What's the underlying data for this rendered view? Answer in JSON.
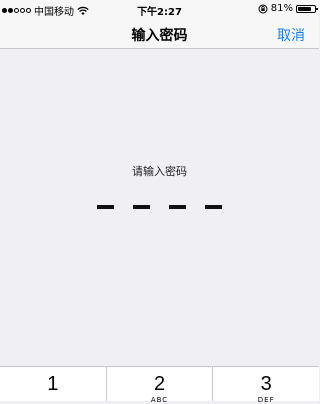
{
  "status_bar": {
    "carrier": "中国移动",
    "time": "下午2:27",
    "battery_percent": "81%",
    "battery_level": 0.81
  },
  "nav": {
    "title": "输入密码",
    "cancel_label": "取消"
  },
  "main": {
    "prompt": "请输入密码",
    "pin_length": 4,
    "entered_digits": 0
  },
  "keypad": {
    "keys": [
      {
        "digit": "1",
        "letters": ""
      },
      {
        "digit": "2",
        "letters": "ABC"
      },
      {
        "digit": "3",
        "letters": "DEF"
      }
    ]
  },
  "colors": {
    "accent": "#1a7ff0",
    "background": "#efeff4"
  }
}
